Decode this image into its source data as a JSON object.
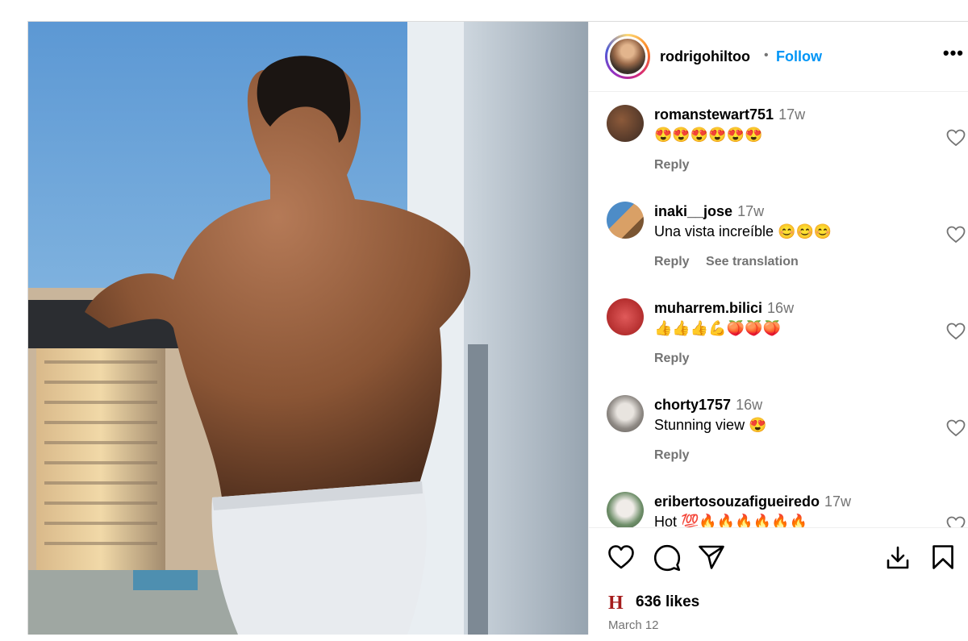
{
  "post": {
    "owner": "rodrigohiltoo",
    "separator": "•",
    "follow_label": "Follow",
    "more_label": "•••",
    "likes": "636 likes",
    "date": "March 12"
  },
  "comments": [
    {
      "user": "romanstewart751",
      "time": "17w",
      "text": "😍😍😍😍😍😍",
      "reply": "Reply",
      "translate": ""
    },
    {
      "user": "inaki__jose",
      "time": "17w",
      "text": "Una vista increíble 😊😊😊",
      "reply": "Reply",
      "translate": "See translation"
    },
    {
      "user": "muharrem.bilici",
      "time": "16w",
      "text": "👍👍👍💪🍑🍑🍑",
      "reply": "Reply",
      "translate": ""
    },
    {
      "user": "chorty1757",
      "time": "16w",
      "text": "Stunning view 😍",
      "reply": "Reply",
      "translate": ""
    },
    {
      "user": "eribertosouzafigueiredo",
      "time": "17w",
      "text": "Hot 💯🔥🔥🔥🔥🔥🔥",
      "reply": "",
      "translate": ""
    }
  ],
  "icons": {
    "like": "heart-icon",
    "comment": "comment-icon",
    "share": "send-icon",
    "download": "download-icon",
    "save": "bookmark-icon",
    "more": "more-icon"
  },
  "colors": {
    "follow": "#0095f6",
    "muted": "#737373",
    "border": "#dbdbdb"
  }
}
